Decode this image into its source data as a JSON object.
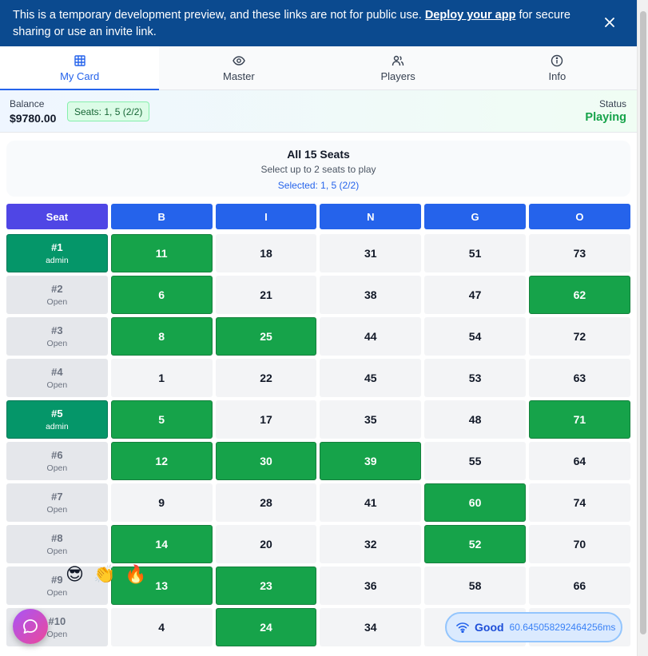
{
  "banner": {
    "text_before": "This is a temporary development preview, and these links are not for public use. ",
    "link_text": "Deploy your app",
    "text_after": " for secure sharing or use an invite link."
  },
  "tabs": [
    {
      "label": "My Card",
      "icon": "grid-icon",
      "active": true
    },
    {
      "label": "Master",
      "icon": "eye-icon",
      "active": false
    },
    {
      "label": "Players",
      "icon": "users-icon",
      "active": false
    },
    {
      "label": "Info",
      "icon": "info-icon",
      "active": false
    }
  ],
  "status": {
    "balance_label": "Balance",
    "balance_value": "$9780.00",
    "seats_chip": "Seats: 1, 5 (2/2)",
    "status_label": "Status",
    "status_value": "Playing"
  },
  "seat_panel": {
    "title": "All 15 Seats",
    "subtitle": "Select up to 2 seats to play",
    "selected": "Selected: 1, 5 (2/2)"
  },
  "grid": {
    "headers": [
      "Seat",
      "B",
      "I",
      "N",
      "G",
      "O"
    ],
    "rows": [
      {
        "seat": "#1",
        "owner": "admin",
        "mine": true,
        "numbers": [
          11,
          18,
          31,
          51,
          73
        ],
        "marked": [
          true,
          false,
          false,
          false,
          false
        ]
      },
      {
        "seat": "#2",
        "owner": "Open",
        "mine": false,
        "numbers": [
          6,
          21,
          38,
          47,
          62
        ],
        "marked": [
          true,
          false,
          false,
          false,
          true
        ]
      },
      {
        "seat": "#3",
        "owner": "Open",
        "mine": false,
        "numbers": [
          8,
          25,
          44,
          54,
          72
        ],
        "marked": [
          true,
          true,
          false,
          false,
          false
        ]
      },
      {
        "seat": "#4",
        "owner": "Open",
        "mine": false,
        "numbers": [
          1,
          22,
          45,
          53,
          63
        ],
        "marked": [
          false,
          false,
          false,
          false,
          false
        ]
      },
      {
        "seat": "#5",
        "owner": "admin",
        "mine": true,
        "numbers": [
          5,
          17,
          35,
          48,
          71
        ],
        "marked": [
          true,
          false,
          false,
          false,
          true
        ]
      },
      {
        "seat": "#6",
        "owner": "Open",
        "mine": false,
        "numbers": [
          12,
          30,
          39,
          55,
          64
        ],
        "marked": [
          true,
          true,
          true,
          false,
          false
        ]
      },
      {
        "seat": "#7",
        "owner": "Open",
        "mine": false,
        "numbers": [
          9,
          28,
          41,
          60,
          74
        ],
        "marked": [
          false,
          false,
          false,
          true,
          false
        ]
      },
      {
        "seat": "#8",
        "owner": "Open",
        "mine": false,
        "numbers": [
          14,
          20,
          32,
          52,
          70
        ],
        "marked": [
          true,
          false,
          false,
          true,
          false
        ]
      },
      {
        "seat": "#9",
        "owner": "Open",
        "mine": false,
        "numbers": [
          13,
          23,
          36,
          58,
          66
        ],
        "marked": [
          true,
          true,
          false,
          false,
          false
        ]
      },
      {
        "seat": "#10",
        "owner": "Open",
        "mine": false,
        "numbers": [
          4,
          24,
          34,
          "",
          ""
        ],
        "marked": [
          false,
          true,
          false,
          false,
          false
        ]
      }
    ]
  },
  "reactions": [
    "😎",
    "👏",
    "🔥"
  ],
  "connection": {
    "quality": "Good",
    "latency": "60.645058292464256ms"
  },
  "colors": {
    "banner": "#0b4a8f",
    "accent": "#2563eb",
    "marked": "#16a34a",
    "my_seat": "#059669",
    "seat_header": "#4f46e5"
  }
}
